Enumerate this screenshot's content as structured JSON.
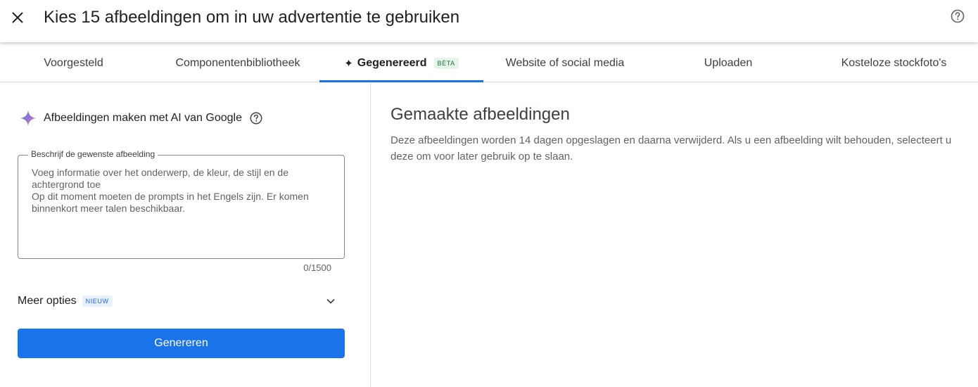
{
  "header": {
    "title": "Kies 15 afbeeldingen om in uw advertentie te gebruiken"
  },
  "tabs": [
    {
      "label": "Voorgesteld"
    },
    {
      "label": "Componentenbibliotheek"
    },
    {
      "label": "Gegenereerd",
      "badge": "BÈTA",
      "active": true
    },
    {
      "label": "Website of social media"
    },
    {
      "label": "Uploaden"
    },
    {
      "label": "Kosteloze stockfoto's"
    }
  ],
  "left": {
    "ai_label": "Afbeeldingen maken met AI van Google",
    "field_label": "Beschrijf de gewenste afbeelding",
    "field_value": "",
    "field_placeholder": "Voeg informatie over het onderwerp, de kleur, de stijl en de achtergrond toe\nOp dit moment moeten de prompts in het Engels zijn. Er komen binnenkort meer talen beschikbaar.",
    "char_count": "0/1500",
    "more_options": "Meer opties",
    "new_badge": "NIEUW",
    "generate_button": "Genereren"
  },
  "right": {
    "title": "Gemaakte afbeeldingen",
    "description": "Deze afbeeldingen worden 14 dagen opgeslagen en daarna verwijderd. Als u een afbeelding wilt behouden, selecteert u deze om voor later gebruik op te slaan."
  },
  "colors": {
    "accent": "#1a73e8",
    "beta_bg": "#e6f4ea",
    "beta_text": "#137333",
    "new_bg": "#e8f0fe",
    "new_text": "#1967d2"
  }
}
